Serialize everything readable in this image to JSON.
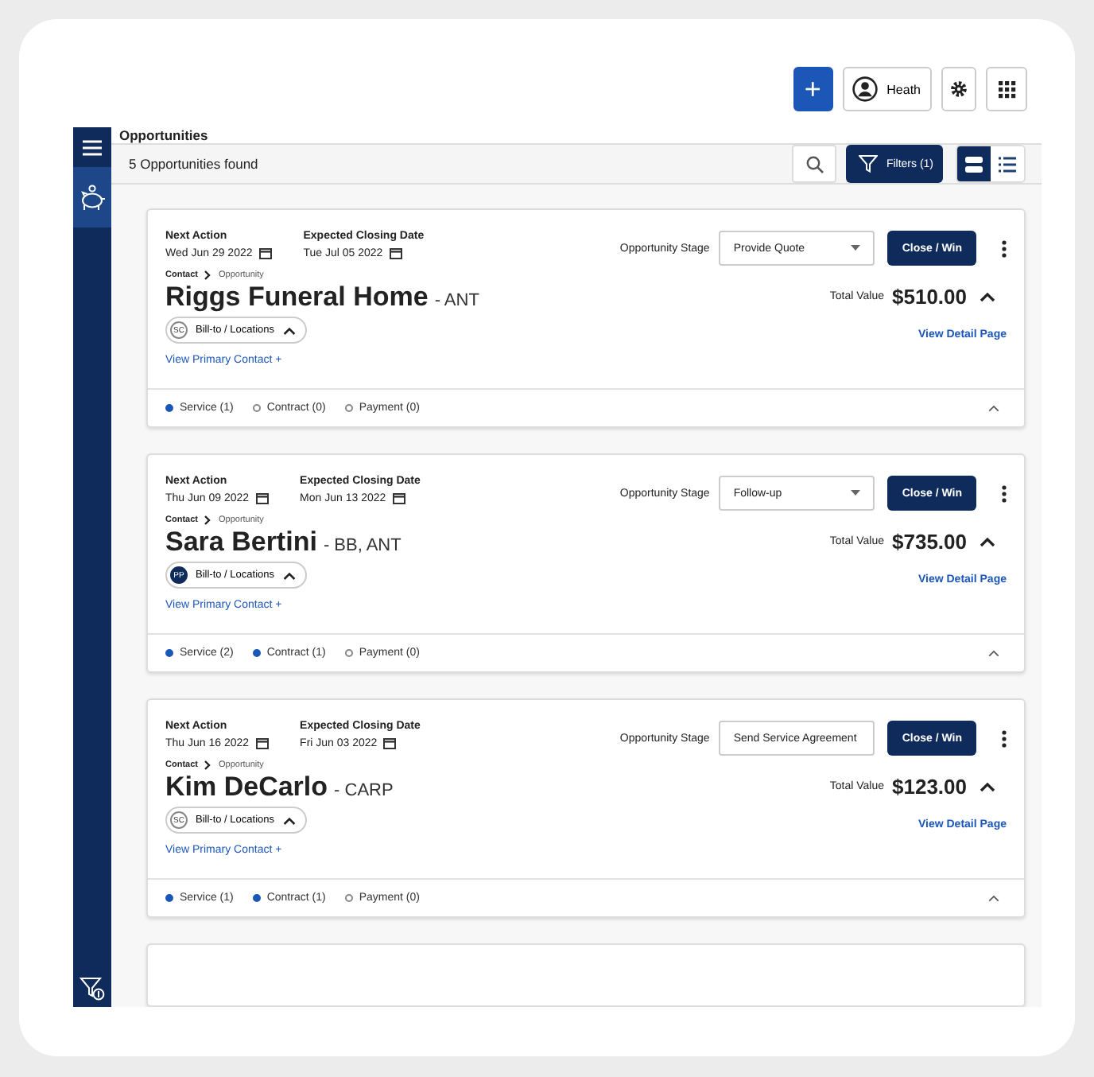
{
  "header_buttons": {
    "add": "+",
    "user": {
      "name": "Heath"
    }
  },
  "page_title": "Opportunities",
  "toolbar": {
    "count": "5 Opportunities found",
    "filters": "Filters (1)",
    "view_modes": [
      {
        "kind": "cards",
        "selected": true
      },
      {
        "kind": "list",
        "selected": false
      }
    ]
  },
  "opportunities": [
    {
      "next_action_label": "Next Action",
      "next_action": "Wed Jun 29 2022",
      "closing_label": "Expected Closing Date",
      "closing": "Tue Jul 05 2022",
      "crumb_contact": "Contact",
      "crumb_page": "Opportunity",
      "name": "Riggs Funeral Home",
      "suffix": "- ANT",
      "badge": {
        "initials": "SC",
        "filled": false
      },
      "locations": "Bill-to / Locations",
      "primary_contact": "View Primary Contact +",
      "stage_label": "Opportunity Stage",
      "stage": "Provide Quote",
      "close_win": "Close / Win",
      "total_label": "Total Value",
      "total": "$510.00",
      "detail_link": "View Detail Page",
      "tabs": [
        {
          "label": "Service (1)",
          "active": true
        },
        {
          "label": "Contract (0)",
          "active": false
        },
        {
          "label": "Payment (0)",
          "active": false
        }
      ]
    },
    {
      "next_action_label": "Next Action",
      "next_action": "Thu Jun 09 2022",
      "closing_label": "Expected Closing Date",
      "closing": "Mon Jun 13 2022",
      "crumb_contact": "Contact",
      "crumb_page": "Opportunity",
      "name": "Sara Bertini",
      "suffix": "- BB, ANT",
      "badge": {
        "initials": "PP",
        "filled": true
      },
      "locations": "Bill-to / Locations",
      "primary_contact": "View Primary Contact +",
      "stage_label": "Opportunity Stage",
      "stage": "Follow-up",
      "close_win": "Close / Win",
      "total_label": "Total Value",
      "total": "$735.00",
      "detail_link": "View Detail Page",
      "tabs": [
        {
          "label": "Service (2)",
          "active": true
        },
        {
          "label": "Contract (1)",
          "active": true
        },
        {
          "label": "Payment (0)",
          "active": false
        }
      ]
    },
    {
      "next_action_label": "Next Action",
      "next_action": "Thu Jun 16 2022",
      "closing_label": "Expected Closing Date",
      "closing": "Fri Jun 03 2022",
      "crumb_contact": "Contact",
      "crumb_page": "Opportunity",
      "name": "Kim DeCarlo",
      "suffix": "- CARP",
      "badge": {
        "initials": "SC",
        "filled": false
      },
      "locations": "Bill-to / Locations",
      "primary_contact": "View Primary Contact +",
      "stage_label": "Opportunity Stage",
      "stage": "Send Service Agreement",
      "close_win": "Close / Win",
      "total_label": "Total Value",
      "total": "$123.00",
      "detail_link": "View Detail Page",
      "tabs": [
        {
          "label": "Service (1)",
          "active": true
        },
        {
          "label": "Contract (1)",
          "active": true
        },
        {
          "label": "Payment (0)",
          "active": false
        }
      ]
    }
  ]
}
